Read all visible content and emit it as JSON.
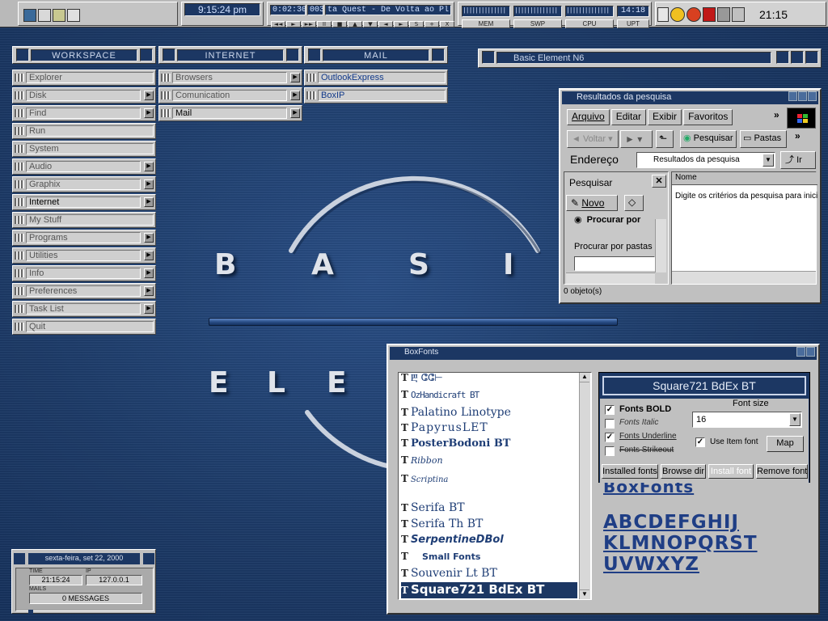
{
  "topbar": {
    "clock": "9:15:24 pm",
    "track_time": "0:02:30",
    "track_num": "003",
    "track_title": "ta Quest - De Volta ao Pl",
    "cpu_readout": "14:18",
    "meters": [
      "MEM",
      "SWP",
      "CPU",
      "UPT"
    ],
    "player_buttons": [
      "◄◄",
      "►",
      "►►",
      "II",
      "■",
      "▲",
      "▼",
      "◄",
      "►",
      "S",
      "+",
      "X"
    ],
    "system_time": "21:15"
  },
  "menus": {
    "workspace": {
      "title": "WORKSPACE",
      "items": [
        "Explorer",
        "Disk",
        "Find",
        "Run",
        "System",
        "Audio",
        "Graphix",
        "Internet",
        "My Stuff",
        "Programs",
        "Utilities",
        "Info",
        "Preferences",
        "Task List",
        "Quit"
      ]
    },
    "internet": {
      "title": "INTERNET",
      "items": [
        "Browsers",
        "Comunication",
        "Mail"
      ]
    },
    "mail": {
      "title": "MAIL",
      "items": [
        "OutlookExpress",
        "BoxIP"
      ]
    }
  },
  "basic_element": {
    "title": "Basic Element N6"
  },
  "logo": {
    "line1": [
      "B",
      "A",
      "S",
      "I"
    ],
    "line2": [
      "E",
      "L",
      "E"
    ]
  },
  "search_window": {
    "title": "Resultados da pesquisa",
    "menu": [
      "Arquivo",
      "Editar",
      "Exibir",
      "Favoritos"
    ],
    "back": "Voltar",
    "search_btn": "Pesquisar",
    "folders_btn": "Pastas",
    "address_label": "Endereço",
    "address_value": "Resultados da pesquisa",
    "go_btn": "Ir",
    "pane_title": "Pesquisar",
    "new_btn": "Novo",
    "find_label": "Procurar por",
    "find_folders": "Procurar por pastas e",
    "col_name": "Nome",
    "hint": "Digite os critérios da pesquisa para inici",
    "status": "0 objeto(s)"
  },
  "boxfonts": {
    "title": "BoxFonts",
    "fonts": [
      "Ⰱ ⵛⵛ⊢",
      "OzHandicraft BT",
      "Palatino Linotype",
      "PapyrusLET",
      "PosterBodoni BT",
      "Ribbon",
      "Scriptina",
      "Serifa BT",
      "Serifa Th BT",
      "SerpentineDBol",
      "Small Fonts",
      "Souvenir Lt BT",
      "Square721 BdEx BT"
    ],
    "selected_font": "Square721 BdEx BT",
    "options": [
      "Fonts BOLD",
      "Fonts Italic",
      "Fonts Underline",
      "Fonts Strikeout"
    ],
    "option_checked": [
      true,
      false,
      true,
      false
    ],
    "size_label": "Font size",
    "size_value": "16",
    "use_item_font": "Use Item font",
    "map_btn": "Map",
    "buttons": [
      "Installed fonts",
      "Browse dir",
      "Install font",
      "Remove font"
    ],
    "preview_title": "BoxFonts",
    "preview_lines": [
      "ABCDEFGHIJ",
      "KLMNOPQRST",
      "UVWXYZ"
    ]
  },
  "status_box": {
    "date": "sexta-feira, set 22, 2000",
    "time_label": "TIME",
    "time_value": "21:15:24",
    "ip_label": "IP",
    "ip_value": "127.0.0.1",
    "mails_label": "MAILS",
    "messages": "0 MESSAGES"
  }
}
